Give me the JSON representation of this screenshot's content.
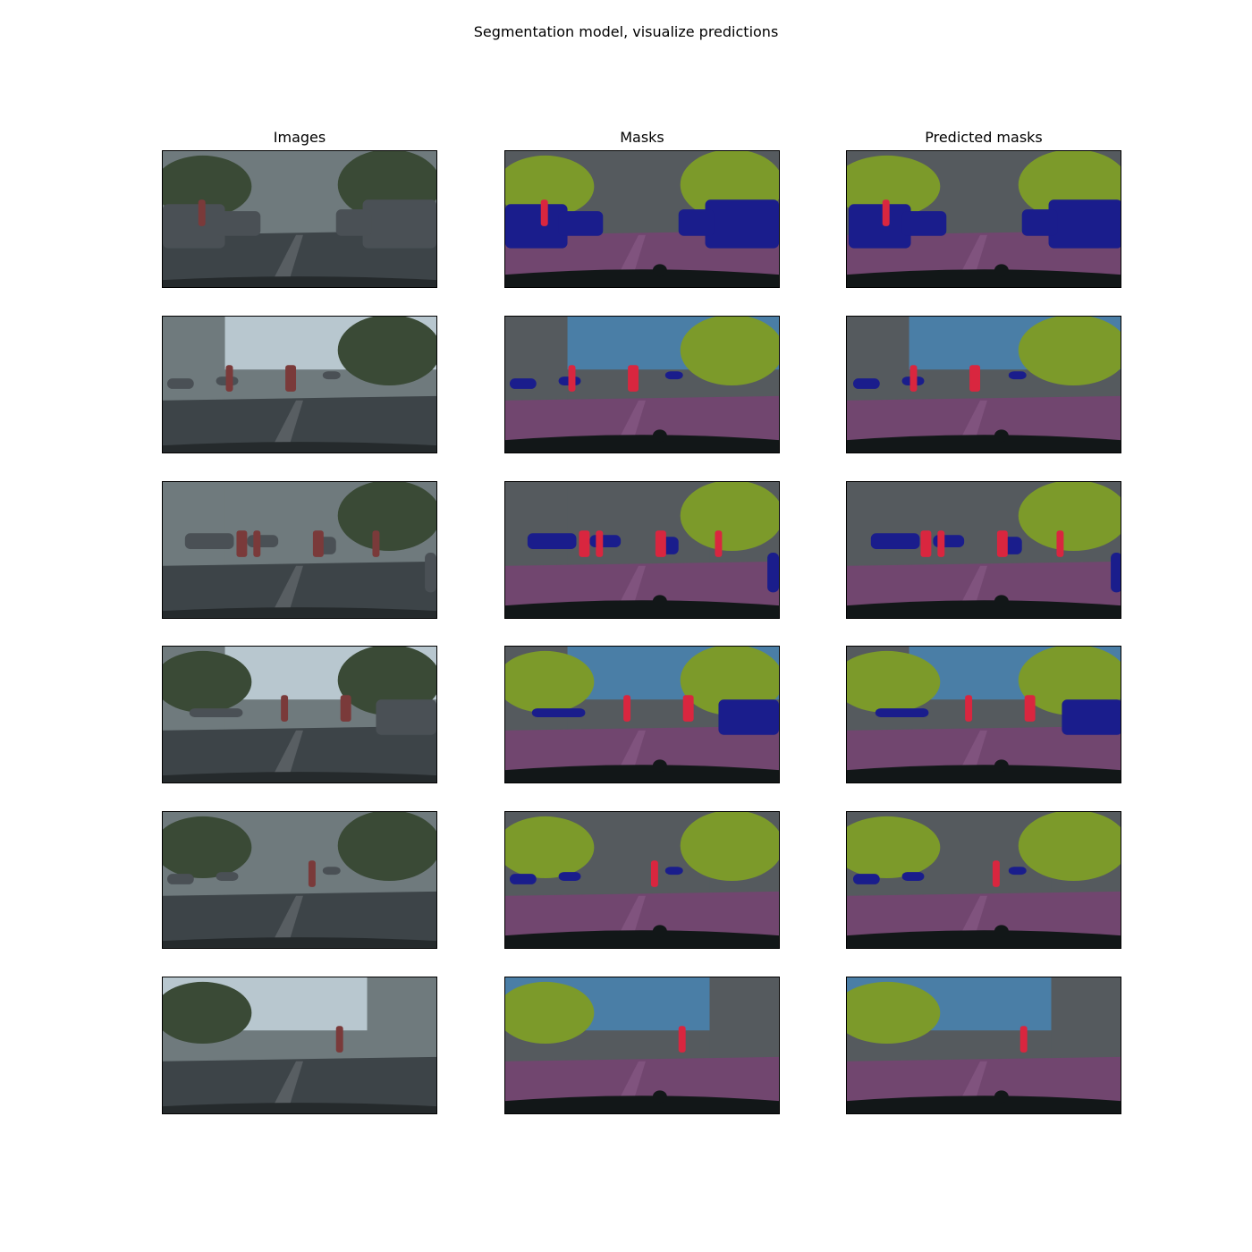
{
  "figure": {
    "title": "Segmentation model, visualize predictions",
    "columns": [
      {
        "id": "images",
        "label": "Images"
      },
      {
        "id": "masks",
        "label": "Masks"
      },
      {
        "id": "predicted",
        "label": "Predicted masks"
      }
    ],
    "row_count": 6
  },
  "colors": {
    "road": "#71466f",
    "road_light": "#8a5c88",
    "car": "#1a1d8c",
    "vegetation": "#7c9a2a",
    "sky": "#4a7ea6",
    "building": "#555a5e",
    "person": "#d9263f",
    "pole": "#a0a0a0",
    "void": "#121718",
    "photo_road": "#3d4448",
    "photo_building": "#6f7a7d",
    "photo_sky": "#b8c7cf",
    "photo_tree": "#3a4a36",
    "photo_car": "#4a5055"
  },
  "rows": [
    {
      "sky": false,
      "veg_left": true,
      "veg_right": true,
      "cars": "both",
      "people": 1,
      "building_left": true,
      "building_right": true
    },
    {
      "sky": true,
      "veg_left": false,
      "veg_right": true,
      "cars": "small",
      "people": 2,
      "building_left": true,
      "building_right": false
    },
    {
      "sky": false,
      "veg_left": false,
      "veg_right": true,
      "cars": "mid",
      "people": 4,
      "building_left": true,
      "building_right": true
    },
    {
      "sky": true,
      "veg_left": true,
      "veg_right": true,
      "cars": "right",
      "people": 2,
      "building_left": true,
      "building_right": false
    },
    {
      "sky": false,
      "veg_left": true,
      "veg_right": true,
      "cars": "small",
      "people": 1,
      "building_left": false,
      "building_right": true
    },
    {
      "sky": true,
      "veg_left": true,
      "veg_right": false,
      "cars": "none",
      "people": 1,
      "building_left": false,
      "building_right": true
    }
  ]
}
